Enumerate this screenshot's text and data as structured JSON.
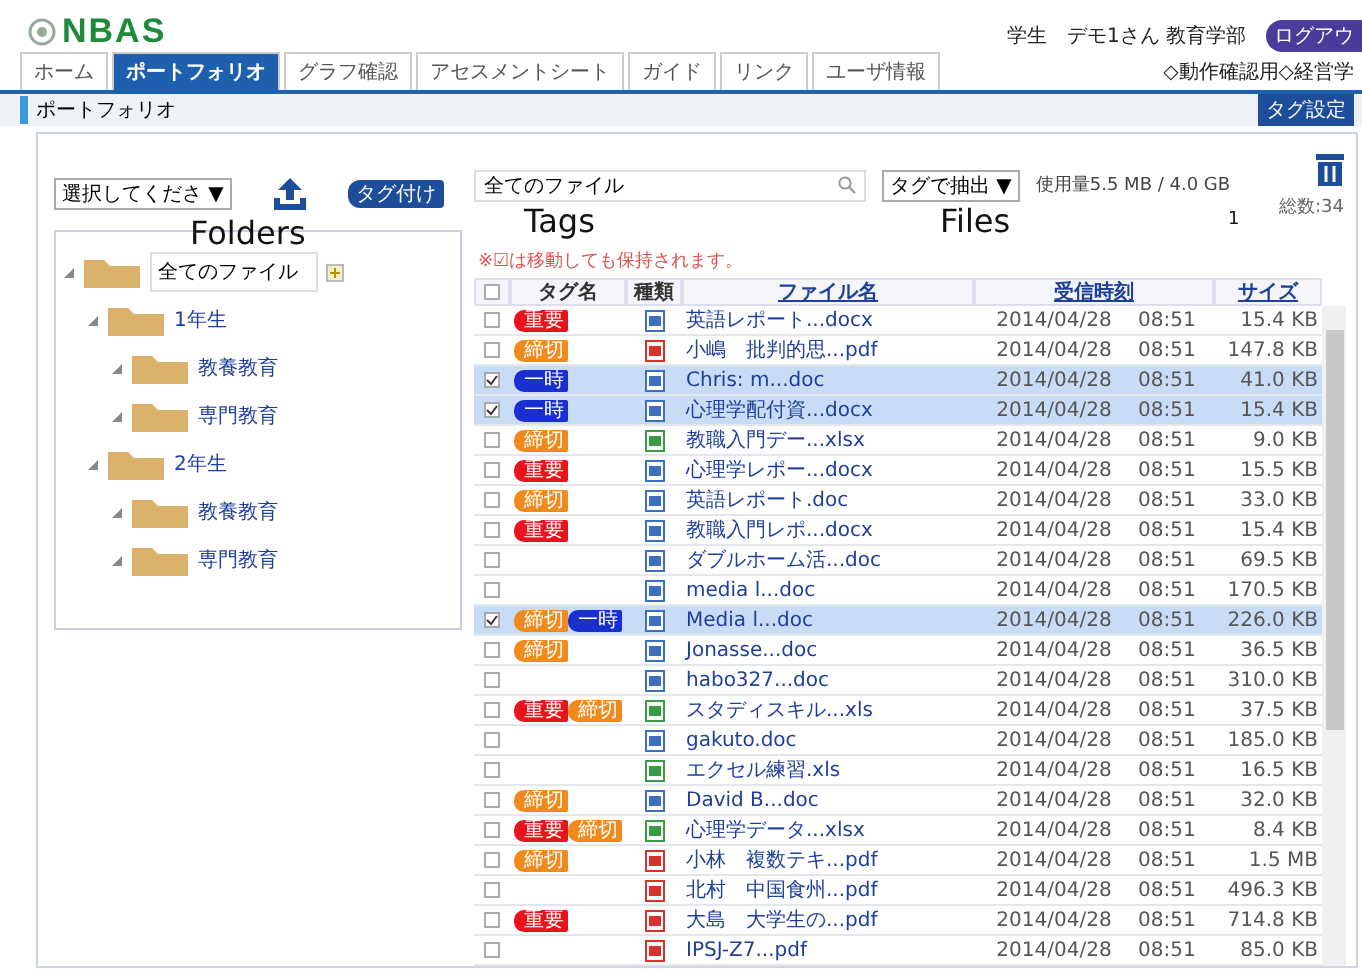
{
  "header": {
    "logo": "NBAS",
    "user": "学生　デモ1さん 教育学部",
    "logout_button": "ログアウ",
    "course": "◇動作確認用◇経営学"
  },
  "tabs": [
    {
      "label": "ホーム",
      "selected": false
    },
    {
      "label": "ポートフォリオ",
      "selected": true
    },
    {
      "label": "グラフ確認",
      "selected": false
    },
    {
      "label": "アセスメントシート",
      "selected": false
    },
    {
      "label": "ガイド",
      "selected": false
    },
    {
      "label": "リンク",
      "selected": false
    },
    {
      "label": "ユーザ情報",
      "selected": false
    }
  ],
  "page_title": "ポートフォリオ",
  "tag_settings_button": "タグ設定",
  "left": {
    "select": "選択してくださ ▼",
    "tag_button": "タグ付け",
    "tree": [
      {
        "label": "全てのファイル",
        "kind": "root",
        "children": [
          {
            "label": "1年生",
            "children": [
              {
                "label": "教養教育"
              },
              {
                "label": "専門教育"
              }
            ]
          },
          {
            "label": "2年生",
            "children": [
              {
                "label": "教養教育"
              },
              {
                "label": "専門教育"
              }
            ]
          }
        ]
      }
    ]
  },
  "right": {
    "search": "全てのファイル",
    "filter_select": "タグで抽出 ▼",
    "all_checked": false,
    "usage": "使用量5.5 MB / 4.0 GB",
    "total": "総数:34",
    "notice": "※☑は移動しても保持されます。",
    "columns": [
      "タグ名",
      "種類",
      "ファイル名",
      "受信時刻",
      "サイズ"
    ],
    "rows": [
      {
        "checked": false,
        "tags": [
          {
            "label": "重要",
            "color": "#e8141b"
          }
        ],
        "kind": "doc",
        "name": "英語レポート...docx",
        "date": "2014/04/28",
        "time": "08:51",
        "size": "15.4 KB"
      },
      {
        "checked": false,
        "tags": [
          {
            "label": "締切",
            "color": "#f08a1c"
          }
        ],
        "kind": "pdf",
        "name": "小嶋　批判的思...pdf",
        "date": "2014/04/28",
        "time": "08:51",
        "size": "147.8 KB"
      },
      {
        "checked": true,
        "tags": [
          {
            "label": "一時",
            "color": "#1a2fd0"
          }
        ],
        "kind": "doc",
        "name": "Chris: m...doc",
        "date": "2014/04/28",
        "time": "08:51",
        "size": "41.0 KB"
      },
      {
        "checked": true,
        "tags": [
          {
            "label": "一時",
            "color": "#1a2fd0"
          }
        ],
        "kind": "doc",
        "name": "心理学配付資...docx",
        "date": "2014/04/28",
        "time": "08:51",
        "size": "15.4 KB"
      },
      {
        "checked": false,
        "tags": [
          {
            "label": "締切",
            "color": "#f08a1c"
          }
        ],
        "kind": "xls",
        "name": "教職入門デー...xlsx",
        "date": "2014/04/28",
        "time": "08:51",
        "size": "9.0 KB"
      },
      {
        "checked": false,
        "tags": [
          {
            "label": "重要",
            "color": "#e8141b"
          }
        ],
        "kind": "doc",
        "name": "心理学レポー...docx",
        "date": "2014/04/28",
        "time": "08:51",
        "size": "15.5 KB"
      },
      {
        "checked": false,
        "tags": [
          {
            "label": "締切",
            "color": "#f08a1c"
          }
        ],
        "kind": "doc",
        "name": "英語レポート.doc",
        "date": "2014/04/28",
        "time": "08:51",
        "size": "33.0 KB"
      },
      {
        "checked": false,
        "tags": [
          {
            "label": "重要",
            "color": "#e8141b"
          }
        ],
        "kind": "doc",
        "name": "教職入門レポ...docx",
        "date": "2014/04/28",
        "time": "08:51",
        "size": "15.4 KB"
      },
      {
        "checked": false,
        "tags": [],
        "kind": "doc",
        "name": "ダブルホーム活...doc",
        "date": "2014/04/28",
        "time": "08:51",
        "size": "69.5 KB"
      },
      {
        "checked": false,
        "tags": [],
        "kind": "doc",
        "name": "media l...doc",
        "date": "2014/04/28",
        "time": "08:51",
        "size": "170.5 KB"
      },
      {
        "checked": true,
        "tags": [
          {
            "label": "締切",
            "color": "#f08a1c"
          },
          {
            "label": "一時",
            "color": "#1a2fd0"
          }
        ],
        "kind": "doc",
        "name": "Media l...doc",
        "date": "2014/04/28",
        "time": "08:51",
        "size": "226.0 KB"
      },
      {
        "checked": false,
        "tags": [
          {
            "label": "締切",
            "color": "#f08a1c"
          }
        ],
        "kind": "doc",
        "name": "Jonasse...doc",
        "date": "2014/04/28",
        "time": "08:51",
        "size": "36.5 KB"
      },
      {
        "checked": false,
        "tags": [],
        "kind": "doc",
        "name": "habo327...doc",
        "date": "2014/04/28",
        "time": "08:51",
        "size": "310.0 KB"
      },
      {
        "checked": false,
        "tags": [
          {
            "label": "重要",
            "color": "#e8141b"
          },
          {
            "label": "締切",
            "color": "#f08a1c"
          }
        ],
        "kind": "xls",
        "name": "スタディスキル...xls",
        "date": "2014/04/28",
        "time": "08:51",
        "size": "37.5 KB"
      },
      {
        "checked": false,
        "tags": [],
        "kind": "doc",
        "name": "gakuto.doc",
        "date": "2014/04/28",
        "time": "08:51",
        "size": "185.0 KB"
      },
      {
        "checked": false,
        "tags": [],
        "kind": "xls",
        "name": "エクセル練習.xls",
        "date": "2014/04/28",
        "time": "08:51",
        "size": "16.5 KB"
      },
      {
        "checked": false,
        "tags": [
          {
            "label": "締切",
            "color": "#f08a1c"
          }
        ],
        "kind": "doc",
        "name": "David B...doc",
        "date": "2014/04/28",
        "time": "08:51",
        "size": "32.0 KB"
      },
      {
        "checked": false,
        "tags": [
          {
            "label": "重要",
            "color": "#e8141b"
          },
          {
            "label": "締切",
            "color": "#f08a1c"
          }
        ],
        "kind": "xls",
        "name": "心理学データ...xlsx",
        "date": "2014/04/28",
        "time": "08:51",
        "size": "8.4 KB"
      },
      {
        "checked": false,
        "tags": [
          {
            "label": "締切",
            "color": "#f08a1c"
          }
        ],
        "kind": "pdf",
        "name": "小林　複数テキ...pdf",
        "date": "2014/04/28",
        "time": "08:51",
        "size": "1.5 MB"
      },
      {
        "checked": false,
        "tags": [],
        "kind": "pdf",
        "name": "北村　中国食州...pdf",
        "date": "2014/04/28",
        "time": "08:51",
        "size": "496.3 KB"
      },
      {
        "checked": false,
        "tags": [
          {
            "label": "重要",
            "color": "#e8141b"
          }
        ],
        "kind": "pdf",
        "name": "大島　大学生の...pdf",
        "date": "2014/04/28",
        "time": "08:51",
        "size": "714.8 KB"
      },
      {
        "checked": false,
        "tags": [],
        "kind": "pdf",
        "name": "IPSJ-Z7...pdf",
        "date": "2014/04/28",
        "time": "08:51",
        "size": "85.0 KB"
      }
    ]
  },
  "annotations": [
    "Folders",
    "Tags",
    "Files",
    "1"
  ]
}
